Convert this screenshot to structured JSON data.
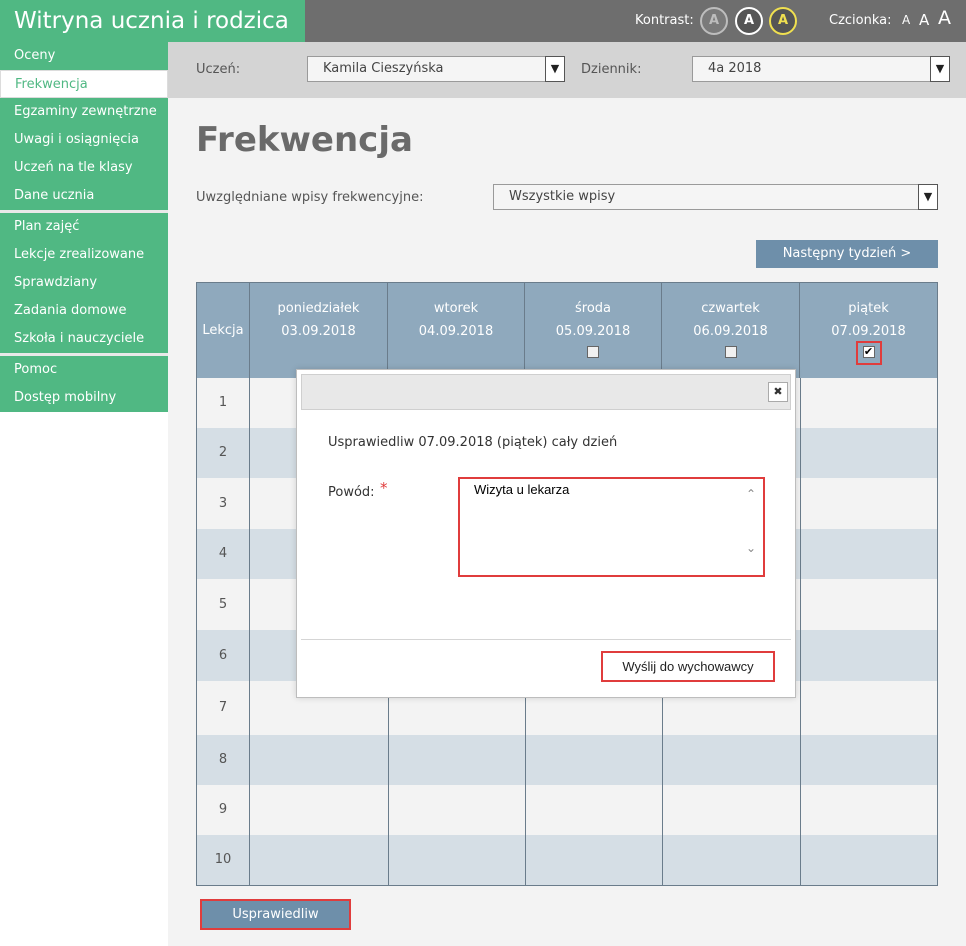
{
  "header": {
    "title": "Witryna ucznia i rodzica",
    "kontrast_label": "Kontrast:",
    "kontrast_options": [
      "A",
      "A",
      "A"
    ],
    "czcionka_label": "Czcionka:",
    "font_sizes": [
      "A",
      "A",
      "A"
    ]
  },
  "sidebar": {
    "items": [
      {
        "label": "Oceny"
      },
      {
        "label": "Frekwencja",
        "active": true
      },
      {
        "label": "Egzaminy zewnętrzne"
      },
      {
        "label": "Uwagi i osiągnięcia"
      },
      {
        "label": "Uczeń na tle klasy"
      },
      {
        "label": "Dane ucznia"
      },
      {
        "label": "Plan zajęć"
      },
      {
        "label": "Lekcje zrealizowane"
      },
      {
        "label": "Sprawdziany"
      },
      {
        "label": "Zadania domowe"
      },
      {
        "label": "Szkoła i nauczyciele"
      },
      {
        "label": "Pomoc"
      },
      {
        "label": "Dostęp mobilny"
      }
    ]
  },
  "selectors": {
    "uczen_label": "Uczeń:",
    "uczen_value": "Kamila Cieszyńska",
    "dziennik_label": "Dziennik:",
    "dziennik_value": "4a 2018"
  },
  "page": {
    "title": "Frekwencja",
    "filter_label": "Uwzględniane wpisy frekwencyjne:",
    "filter_value": "Wszystkie wpisy",
    "next_week": "Następny tydzień >",
    "justify_button": "Usprawiedliw"
  },
  "table": {
    "lekcja_header": "Lekcja",
    "days": [
      {
        "name": "poniedziałek",
        "date": "03.09.2018"
      },
      {
        "name": "wtorek",
        "date": "04.09.2018"
      },
      {
        "name": "środa",
        "date": "05.09.2018",
        "checkbox": "unchecked"
      },
      {
        "name": "czwartek",
        "date": "06.09.2018",
        "checkbox": "unchecked"
      },
      {
        "name": "piątek",
        "date": "07.09.2018",
        "checkbox": "checked"
      }
    ],
    "lessons": [
      "1",
      "2",
      "3",
      "4",
      "5",
      "6",
      "7",
      "8",
      "9",
      "10"
    ]
  },
  "modal": {
    "close_glyph": "✖",
    "message": "Usprawiedliw 07.09.2018 (piątek) cały dzień",
    "reason_label": "Powód:",
    "required_marker": "*",
    "reason_value": "Wizyta u lekarza",
    "send_button": "Wyślij do wychowawcy"
  },
  "icons": {
    "dropdown": "chevron-down-icon",
    "checkmark": "checkmark-icon",
    "close": "close-icon"
  },
  "colors": {
    "brand_green": "#50b883",
    "topbar_gray": "#6e6e6e",
    "header_blue": "#8fa9bd",
    "button_blue": "#6e8faa",
    "highlight_red": "#e03c3c"
  }
}
